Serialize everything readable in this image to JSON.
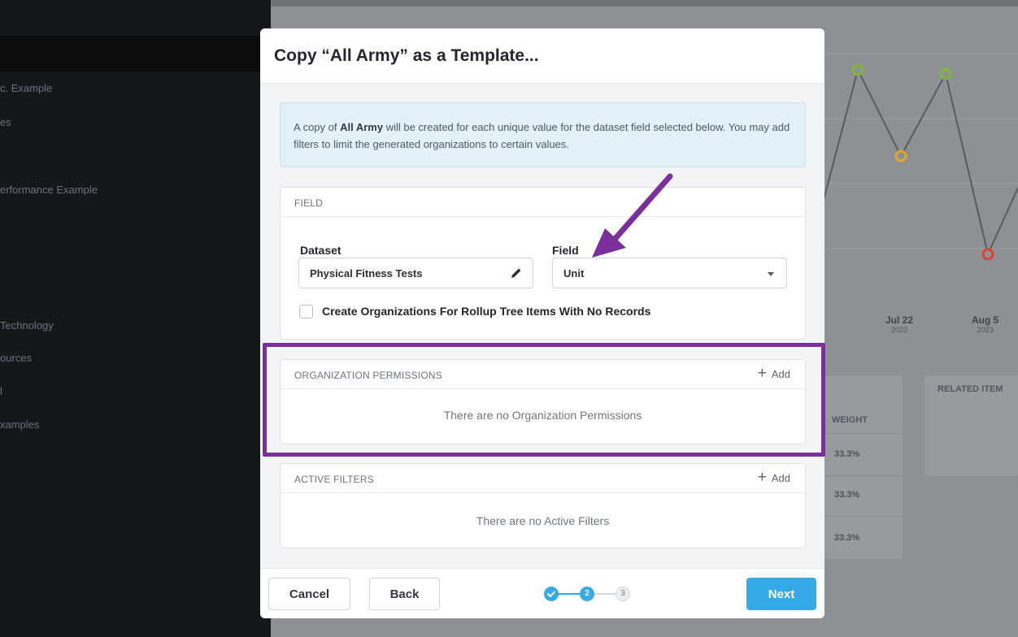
{
  "background": {
    "sidebar_items": [
      "c. Example",
      "es",
      "erformance Example",
      "Technology",
      "ources",
      "l",
      "xamples"
    ],
    "chart_ticks": [
      {
        "label": "Jul 22",
        "year": "2023"
      },
      {
        "label": "Aug 5",
        "year": "2023"
      }
    ],
    "panel_headers": {
      "weight": "WEIGHT",
      "related": "RELATED ITEM"
    },
    "weights": [
      "33.3%",
      "33.3%",
      "33.3%"
    ],
    "marker_colors": {
      "green": "#7fb832",
      "yellow": "#e0a82e",
      "red": "#e0442d"
    }
  },
  "modal": {
    "title": "Copy “All Army” as a Template...",
    "info": {
      "prefix": "A copy of ",
      "bold": "All Army",
      "suffix": " will be created for each unique value for the dataset field selected below. You may add filters to limit the generated organizations to certain values."
    },
    "field_section": {
      "header": "FIELD",
      "dataset_label": "Dataset",
      "dataset_value": "Physical Fitness Tests",
      "field_label": "Field",
      "field_value": "Unit",
      "checkbox_label": "Create Organizations For Rollup Tree Items With No Records",
      "checkbox_checked": false
    },
    "org_permissions": {
      "header": "ORGANIZATION PERMISSIONS",
      "add_label": "Add",
      "empty_text": "There are no Organization Permissions"
    },
    "active_filters": {
      "header": "ACTIVE FILTERS",
      "add_label": "Add",
      "empty_text": "There are no Active Filters"
    },
    "footer": {
      "cancel_label": "Cancel",
      "back_label": "Back",
      "next_label": "Next",
      "steps": [
        "1",
        "2",
        "3"
      ],
      "current_step": 2
    }
  },
  "colors": {
    "primary": "#36a9e8",
    "annotation": "#7a2f9a"
  }
}
